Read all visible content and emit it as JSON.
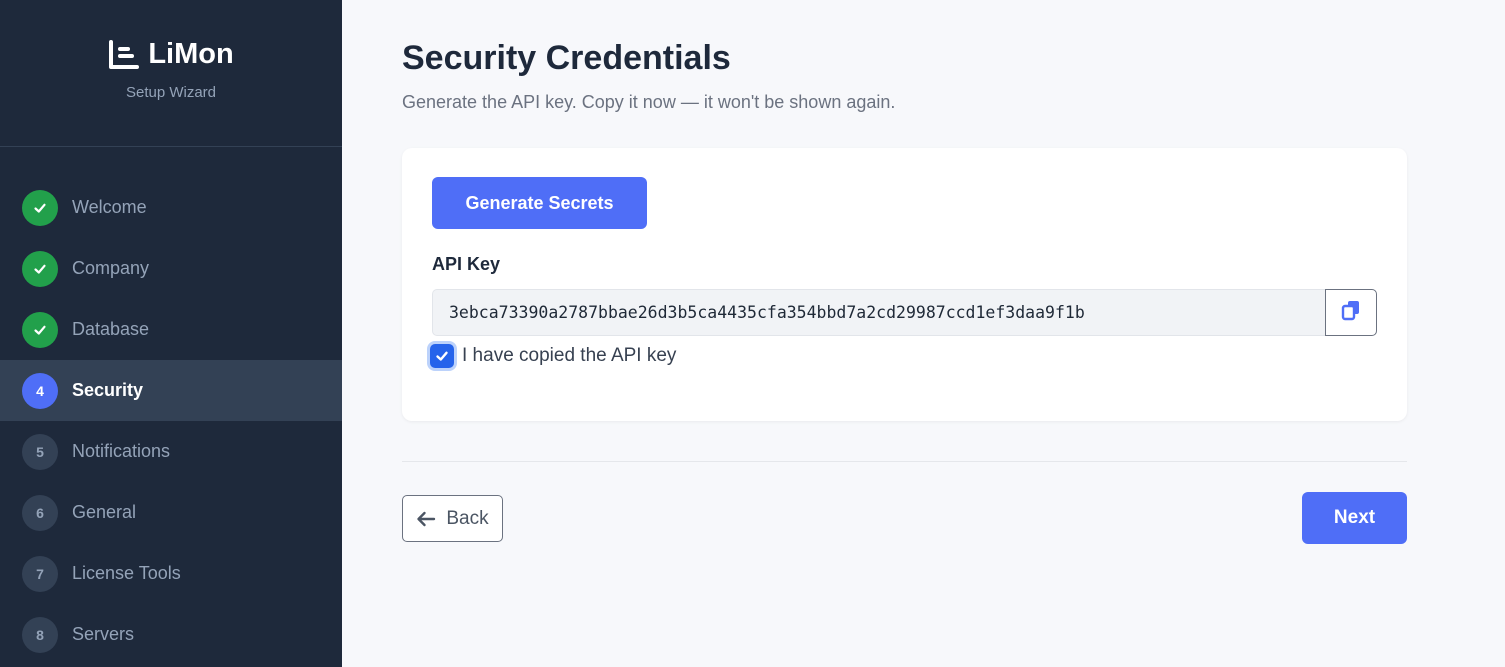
{
  "app": {
    "name": "LiMon",
    "subtitle": "Setup Wizard",
    "logo_icon": "chart-list-icon"
  },
  "steps": [
    {
      "badge": "",
      "label": "Welcome",
      "status": "done"
    },
    {
      "badge": "",
      "label": "Company",
      "status": "done"
    },
    {
      "badge": "",
      "label": "Database",
      "status": "done"
    },
    {
      "badge": "4",
      "label": "Security",
      "status": "active"
    },
    {
      "badge": "5",
      "label": "Notifications",
      "status": "pending"
    },
    {
      "badge": "6",
      "label": "General",
      "status": "pending"
    },
    {
      "badge": "7",
      "label": "License Tools",
      "status": "pending"
    },
    {
      "badge": "8",
      "label": "Servers",
      "status": "pending"
    }
  ],
  "page": {
    "title": "Security Credentials",
    "subtitle": "Generate the API key. Copy it now — it won't be shown again."
  },
  "card": {
    "generate_label": "Generate Secrets",
    "api_key_label": "API Key",
    "api_key_value": "3ebca73390a2787bbae26d3b5ca4435cfa354bbd7a2cd29987ccd1ef3daa9f1b",
    "copy_icon": "copy-icon",
    "confirm_label": "I have copied the API key",
    "confirm_checked": true
  },
  "footer": {
    "back_label": "Back",
    "next_label": "Next"
  },
  "colors": {
    "sidebar": "#1e293b",
    "accent": "#4f6ef7",
    "success": "#22a04b",
    "checkbox": "#2563eb"
  }
}
